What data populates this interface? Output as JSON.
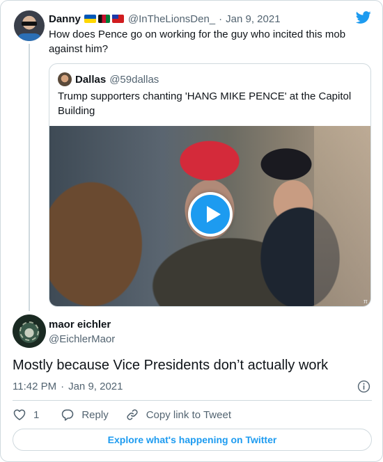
{
  "parent_tweet": {
    "name": "Danny",
    "handle": "@InTheLionsDen_",
    "separator": "·",
    "date": "Jan 9, 2021",
    "text": "How does Pence go on working for the guy who incited this mob against him?"
  },
  "quoted_tweet": {
    "name": "Dallas",
    "handle": "@59dallas",
    "text": "Trump supporters chanting 'HANG MIKE PENCE' at the Capitol Building",
    "video_watermark": "π"
  },
  "main_tweet": {
    "name": "maor eichler",
    "handle": "@EichlerMaor",
    "text": "Mostly because Vice Presidents don’t actually work",
    "time": "11:42 PM",
    "separator": "·",
    "date": "Jan 9, 2021"
  },
  "actions": {
    "like_count": "1",
    "reply_label": "Reply",
    "copy_link_label": "Copy link to Tweet"
  },
  "explore_label": "Explore what's happening on Twitter",
  "colors": {
    "accent": "#1d9bf0",
    "text": "#0f1419",
    "secondary": "#536471",
    "border": "#cfd9de"
  },
  "icons": [
    "twitter-bird-icon",
    "play-icon",
    "info-icon",
    "heart-icon",
    "reply-icon",
    "link-icon",
    "flag-ukraine-icon",
    "flag-afghanistan-icon",
    "flag-taiwan-icon"
  ]
}
